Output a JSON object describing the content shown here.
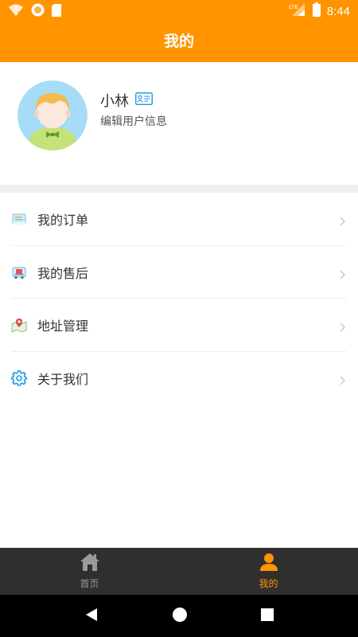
{
  "status_bar": {
    "time": "8:44",
    "network": "LTE",
    "icons": [
      "wifi-icon",
      "app-notification-icon",
      "sd-card-icon",
      "signal-icon",
      "battery-icon"
    ]
  },
  "header": {
    "title": "我的"
  },
  "profile": {
    "name": "小林",
    "edit_label": "编辑用户信息",
    "avatar_icon": "avatar-boy-icon",
    "id_card_icon": "id-card-icon"
  },
  "menu": {
    "items": [
      {
        "label": "我的订单",
        "icon": "orders-icon"
      },
      {
        "label": "我的售后",
        "icon": "after-sales-icon"
      },
      {
        "label": "地址管理",
        "icon": "address-icon"
      },
      {
        "label": "关于我们",
        "icon": "gear-icon"
      }
    ],
    "chevron_icon": "chevron-right-icon"
  },
  "tabs": [
    {
      "label": "首页",
      "icon": "home-icon",
      "active": false
    },
    {
      "label": "我的",
      "icon": "person-icon",
      "active": true
    }
  ],
  "colors": {
    "accent": "#ff9400",
    "tab_bar": "#2f2f2f",
    "inactive_tab": "#9a9a9a",
    "link_blue": "#2a9fd6"
  },
  "nav_bar": {
    "buttons": [
      "back-icon",
      "home-circle-icon",
      "recents-icon"
    ]
  }
}
